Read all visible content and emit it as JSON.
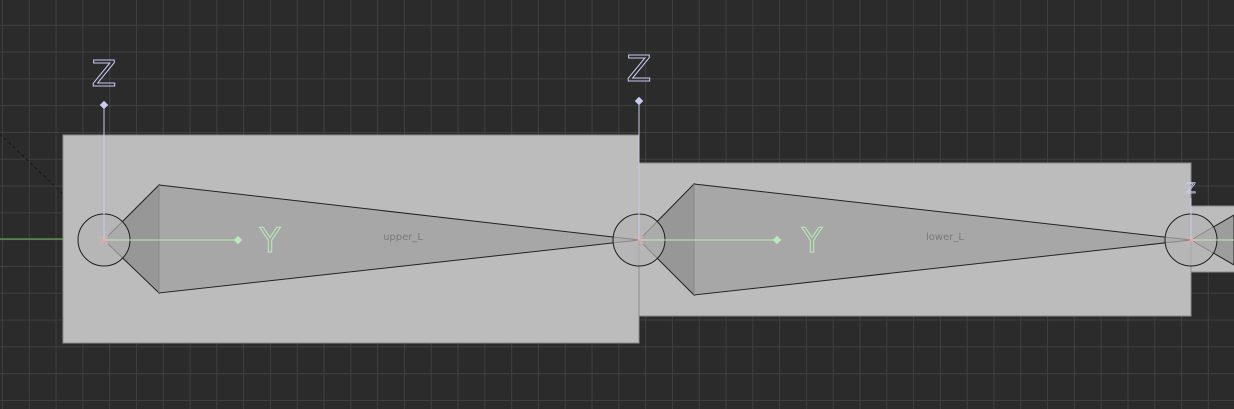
{
  "viewport": {
    "name": "3d-viewport"
  },
  "colors": {
    "background": "#2b2b2b",
    "grid": "#3f3f3f",
    "box_fill": "#bcbcbc",
    "bone_fill": "#a7a7a7",
    "bone_shade": "#979797",
    "joint_fill": "#b4b4b4",
    "axis_z": "#c9c9f2",
    "axis_y": "#b7ecb7",
    "axis_x": "#f2a8a8"
  },
  "joints": [
    {
      "axis_z_label": "Z",
      "axis_y_label": "Y"
    },
    {
      "axis_z_label": "Z",
      "axis_y_label": "Y"
    },
    {
      "axis_z_label": "Z"
    }
  ],
  "bones": [
    {
      "label": "upper_L"
    },
    {
      "label": "lower_L"
    }
  ]
}
